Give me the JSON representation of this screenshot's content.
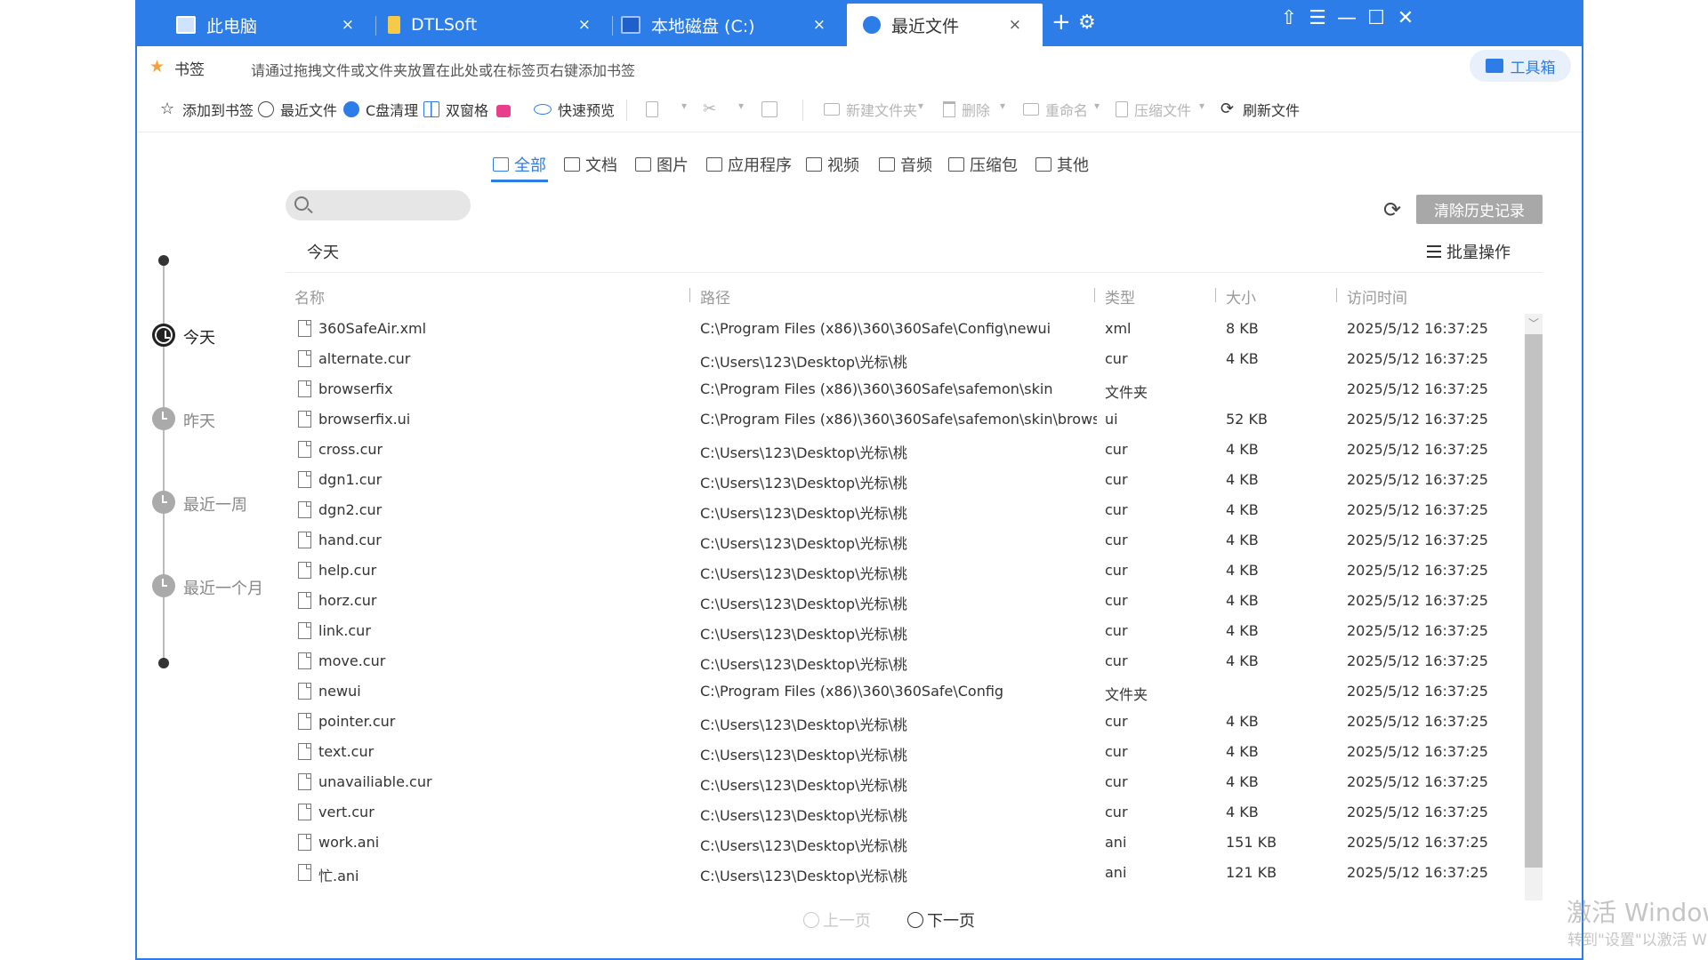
{
  "tabs": [
    {
      "label": "此电脑",
      "icon": "computer-icon",
      "active": false
    },
    {
      "label": "DTLSoft",
      "icon": "folder-icon",
      "active": false
    },
    {
      "label": "本地磁盘 (C:)",
      "icon": "drive-icon",
      "active": false
    },
    {
      "label": "最近文件",
      "icon": "recent-check-icon",
      "active": true
    }
  ],
  "tab_close_glyph": "×",
  "window_controls": {
    "skin": "⇧",
    "menu": "☰",
    "minimize": "—",
    "maximize": "☐",
    "close": "✕"
  },
  "bookmarks": {
    "label": "书签",
    "hint": "请通过拖拽文件或文件夹放置在此处或在标签页右键添加书签",
    "toolbox": "工具箱"
  },
  "toolbar": {
    "add_bookmark": "添加到书签",
    "recent_files": "最近文件",
    "c_clean": "C盘清理",
    "dual_pane": "双窗格",
    "quick_preview": "快速预览",
    "new_folder": "新建文件夹",
    "delete": "删除",
    "rename": "重命名",
    "compress": "压缩文件",
    "refresh": "刷新文件"
  },
  "categories": [
    "全部",
    "文档",
    "图片",
    "应用程序",
    "视频",
    "音频",
    "压缩包",
    "其他"
  ],
  "search": {
    "placeholder": ""
  },
  "actions": {
    "clear_history": "清除历史记录",
    "batch": "批量操作"
  },
  "timeline": [
    "今天",
    "昨天",
    "最近一周",
    "最近一个月"
  ],
  "section_title": "今天",
  "columns": {
    "name": "名称",
    "path": "路径",
    "type": "类型",
    "size": "大小",
    "time": "访问时间"
  },
  "files": [
    {
      "name": "360SafeAir.xml",
      "path": "C:\\Program Files (x86)\\360\\360Safe\\Config\\newui",
      "type": "xml",
      "size": "8 KB",
      "time": "2025/5/12 16:37:25"
    },
    {
      "name": "alternate.cur",
      "path": "C:\\Users\\123\\Desktop\\光标\\桃",
      "type": "cur",
      "size": "4 KB",
      "time": "2025/5/12 16:37:25"
    },
    {
      "name": "browserfix",
      "path": "C:\\Program Files (x86)\\360\\360Safe\\safemon\\skin",
      "type": "文件夹",
      "size": "",
      "time": "2025/5/12 16:37:25"
    },
    {
      "name": "browserfix.ui",
      "path": "C:\\Program Files (x86)\\360\\360Safe\\safemon\\skin\\brows",
      "type": "ui",
      "size": "52 KB",
      "time": "2025/5/12 16:37:25"
    },
    {
      "name": "cross.cur",
      "path": "C:\\Users\\123\\Desktop\\光标\\桃",
      "type": "cur",
      "size": "4 KB",
      "time": "2025/5/12 16:37:25"
    },
    {
      "name": "dgn1.cur",
      "path": "C:\\Users\\123\\Desktop\\光标\\桃",
      "type": "cur",
      "size": "4 KB",
      "time": "2025/5/12 16:37:25"
    },
    {
      "name": "dgn2.cur",
      "path": "C:\\Users\\123\\Desktop\\光标\\桃",
      "type": "cur",
      "size": "4 KB",
      "time": "2025/5/12 16:37:25"
    },
    {
      "name": "hand.cur",
      "path": "C:\\Users\\123\\Desktop\\光标\\桃",
      "type": "cur",
      "size": "4 KB",
      "time": "2025/5/12 16:37:25"
    },
    {
      "name": "help.cur",
      "path": "C:\\Users\\123\\Desktop\\光标\\桃",
      "type": "cur",
      "size": "4 KB",
      "time": "2025/5/12 16:37:25"
    },
    {
      "name": "horz.cur",
      "path": "C:\\Users\\123\\Desktop\\光标\\桃",
      "type": "cur",
      "size": "4 KB",
      "time": "2025/5/12 16:37:25"
    },
    {
      "name": "link.cur",
      "path": "C:\\Users\\123\\Desktop\\光标\\桃",
      "type": "cur",
      "size": "4 KB",
      "time": "2025/5/12 16:37:25"
    },
    {
      "name": "move.cur",
      "path": "C:\\Users\\123\\Desktop\\光标\\桃",
      "type": "cur",
      "size": "4 KB",
      "time": "2025/5/12 16:37:25"
    },
    {
      "name": "newui",
      "path": "C:\\Program Files (x86)\\360\\360Safe\\Config",
      "type": "文件夹",
      "size": "",
      "time": "2025/5/12 16:37:25"
    },
    {
      "name": "pointer.cur",
      "path": "C:\\Users\\123\\Desktop\\光标\\桃",
      "type": "cur",
      "size": "4 KB",
      "time": "2025/5/12 16:37:25"
    },
    {
      "name": "text.cur",
      "path": "C:\\Users\\123\\Desktop\\光标\\桃",
      "type": "cur",
      "size": "4 KB",
      "time": "2025/5/12 16:37:25"
    },
    {
      "name": "unavailiable.cur",
      "path": "C:\\Users\\123\\Desktop\\光标\\桃",
      "type": "cur",
      "size": "4 KB",
      "time": "2025/5/12 16:37:25"
    },
    {
      "name": "vert.cur",
      "path": "C:\\Users\\123\\Desktop\\光标\\桃",
      "type": "cur",
      "size": "4 KB",
      "time": "2025/5/12 16:37:25"
    },
    {
      "name": "work.ani",
      "path": "C:\\Users\\123\\Desktop\\光标\\桃",
      "type": "ani",
      "size": "151 KB",
      "time": "2025/5/12 16:37:25"
    },
    {
      "name": "忙.ani",
      "path": "C:\\Users\\123\\Desktop\\光标\\桃",
      "type": "ani",
      "size": "121 KB",
      "time": "2025/5/12 16:37:25"
    }
  ],
  "pagination": {
    "prev": "上一页",
    "next": "下一页"
  },
  "watermark": {
    "line1": "激活 Windows",
    "line2": "转到\"设置\"以激活 Windows。"
  },
  "colors": {
    "accent": "#2d7de8",
    "tab_bar": "#2d7de8",
    "star": "#f2a33a",
    "lock": "#e83e8c",
    "clear_button": "#a8a8a8"
  }
}
